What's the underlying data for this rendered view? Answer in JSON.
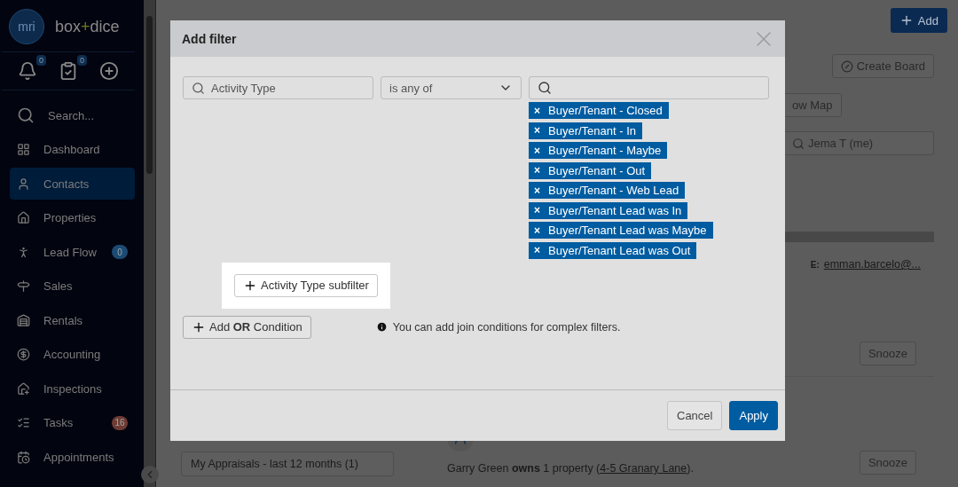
{
  "sidebar": {
    "logo_mark": "mri",
    "brand_left": "box",
    "brand_plus": "+",
    "brand_right": "dice",
    "quick_icons": [
      {
        "kind": "bell",
        "badge": "0"
      },
      {
        "kind": "tasks",
        "badge": "0"
      },
      {
        "kind": "add"
      }
    ],
    "items": [
      {
        "kind": "search",
        "label": "Search...",
        "selected": false
      },
      {
        "kind": "dashboard",
        "label": "Dashboard",
        "selected": false
      },
      {
        "kind": "contacts",
        "label": "Contacts",
        "selected": true
      },
      {
        "kind": "properties",
        "label": "Properties",
        "selected": false
      },
      {
        "kind": "leadflow",
        "label": "Lead Flow",
        "selected": false,
        "badge": "0",
        "color": "#1d4a73"
      },
      {
        "kind": "sales",
        "label": "Sales",
        "selected": false
      },
      {
        "kind": "rentals",
        "label": "Rentals",
        "selected": false
      },
      {
        "kind": "accounting",
        "label": "Accounting",
        "selected": false
      },
      {
        "kind": "inspections",
        "label": "Inspections",
        "selected": false
      },
      {
        "kind": "tasks",
        "label": "Tasks",
        "selected": false,
        "badge": "16",
        "color": "#6e3a33"
      },
      {
        "kind": "appointments",
        "label": "Appointments",
        "selected": false
      }
    ]
  },
  "page": {
    "add_button": "Add",
    "create_board": "Create Board",
    "show_map": "ow Map",
    "owner_search": "Jema T (me)",
    "saved_search": "My Appraisals - last 12 months (1)",
    "email_label": "E:",
    "email": "emman.barcelo@...",
    "snooze_buttons": [
      "Snooze",
      "Snooze"
    ],
    "ownership": {
      "before": "Garry Green **owns** 1 property (",
      "link": "4-5 Granary Lane",
      "after": ")."
    }
  },
  "modal": {
    "title": "Add filter",
    "field": "Activity Type",
    "operator": "is any of",
    "values": [
      "Buyer/Tenant - Closed",
      "Buyer/Tenant - In",
      "Buyer/Tenant - Maybe",
      "Buyer/Tenant - Out",
      "Buyer/Tenant - Web Lead",
      "Buyer/Tenant Lead was In",
      "Buyer/Tenant Lead was Maybe",
      "Buyer/Tenant Lead was Out"
    ],
    "tag_remove": "×",
    "subfilter_button": "Activity Type subfilter",
    "condition_button": "Add **OR** Condition",
    "info": "You can add join conditions for complex filters.",
    "cancel": "Cancel",
    "apply": "Apply"
  }
}
